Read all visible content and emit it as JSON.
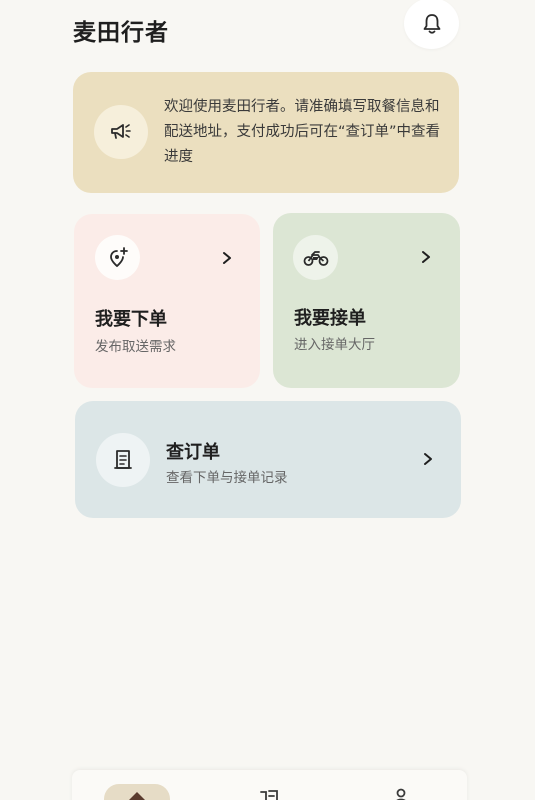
{
  "header": {
    "app_title": "麦田行者"
  },
  "notice": {
    "text": "欢迎使用麦田行者。请准确填写取餐信息和配送地址，支付成功后可在“查订单”中查看进度"
  },
  "cards": {
    "order": {
      "title": "我要下单",
      "subtitle": "发布取送需求"
    },
    "accept": {
      "title": "我要接单",
      "subtitle": "进入接单大厅"
    },
    "query": {
      "title": "查订单",
      "subtitle": "查看下单与接单记录"
    }
  },
  "colors": {
    "background": "#f8f7f3",
    "notice_bg": "#ebdfbf",
    "order_bg": "#fbece8",
    "accept_bg": "#dce6d4",
    "query_bg": "#dce6e7",
    "nav_active": "#e6dcc6"
  },
  "icons": {
    "bell": "bell-icon",
    "notice": "megaphone-icon",
    "order": "location-add-icon",
    "accept": "motorcycle-icon",
    "query": "receipt-icon",
    "chevron": "chevron-right-icon",
    "nav_home": "home-icon",
    "nav_orders": "orders-icon",
    "nav_profile": "profile-icon"
  }
}
